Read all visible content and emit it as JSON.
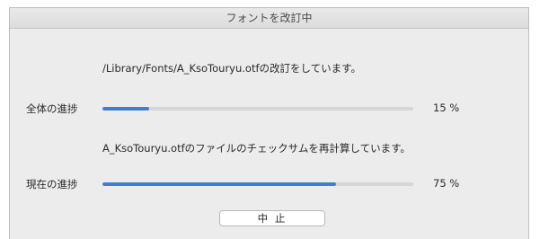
{
  "window": {
    "title": "フォントを改訂中"
  },
  "status": {
    "file_message": "/Library/Fonts/A_KsoTouryu.otfの改訂をしています。",
    "checksum_message": "A_KsoTouryu.otfのファイルのチェックサムを再計算しています。"
  },
  "progress": {
    "overall": {
      "label": "全体の進捗",
      "value": 15,
      "display": "15 %"
    },
    "current": {
      "label": "現在の進捗",
      "value": 75,
      "display": "75 %"
    }
  },
  "buttons": {
    "cancel_label": "中 止"
  },
  "colors": {
    "accent": "#3f7fd0",
    "track": "#d6d6d6",
    "window_bg": "#ececec"
  }
}
